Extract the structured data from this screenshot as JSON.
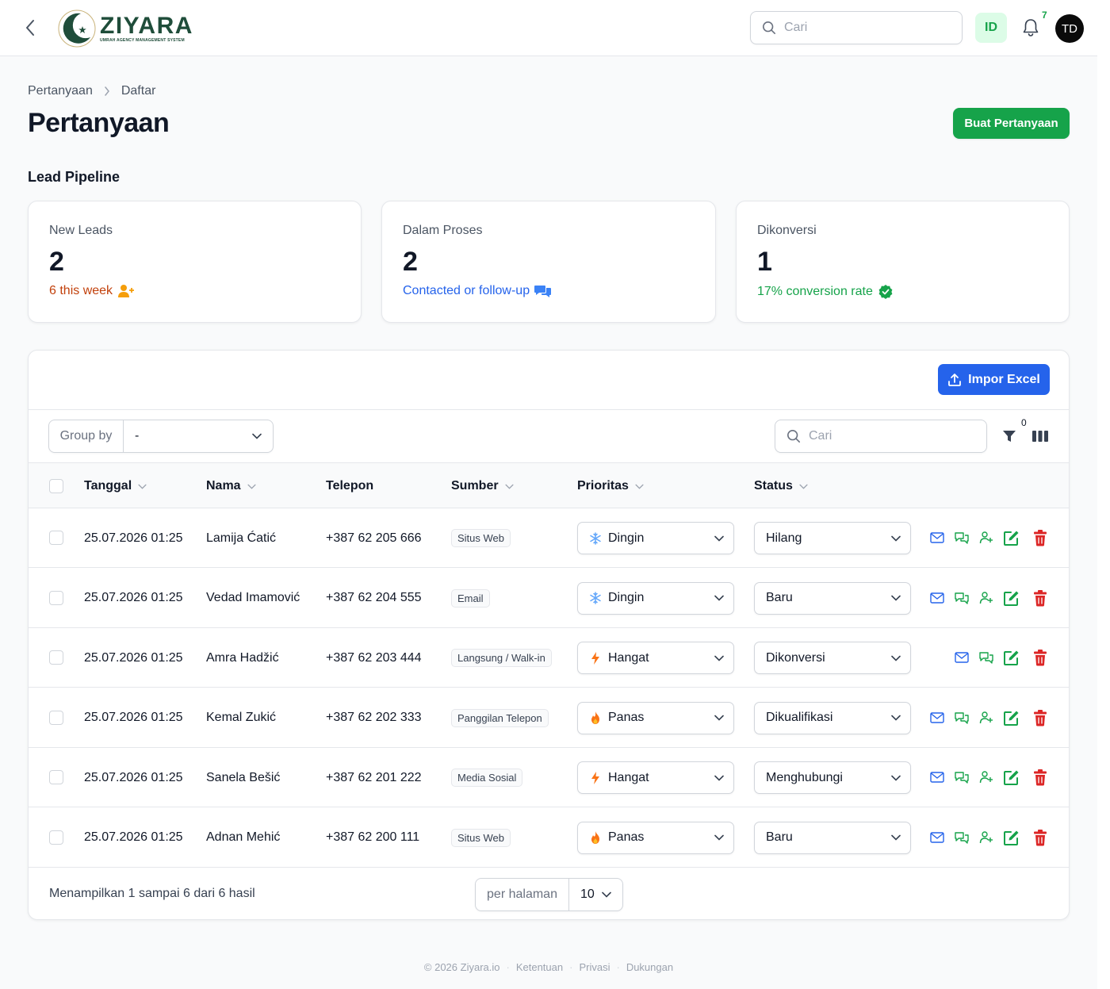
{
  "app": {
    "name": "ZIYARA",
    "tagline": "UMRAH AGENCY MANAGEMENT SYSTEM",
    "brand_color": "#1f4d3a",
    "accent_color": "#16a34a"
  },
  "topbar": {
    "search_placeholder": "Cari",
    "lang": "ID",
    "notification_count": "7",
    "avatar_initials": "TD"
  },
  "breadcrumb": [
    "Pertanyaan",
    "Daftar"
  ],
  "page": {
    "title": "Pertanyaan",
    "create_button": "Buat Pertanyaan",
    "section_title": "Lead Pipeline"
  },
  "stats": [
    {
      "label": "New Leads",
      "value": "2",
      "desc": "6 this week",
      "color": "#c2410c",
      "icon": "user-plus-icon"
    },
    {
      "label": "Dalam Proses",
      "value": "2",
      "desc": "Contacted or follow-up",
      "color": "#2563eb",
      "icon": "chat-bubbles-icon"
    },
    {
      "label": "Dikonversi",
      "value": "1",
      "desc": "17% conversion rate",
      "color": "#16a34a",
      "icon": "check-badge-icon"
    }
  ],
  "table": {
    "import_button": "Impor Excel",
    "group_by_label": "Group by",
    "group_by_value": "-",
    "search_placeholder": "Cari",
    "filter_count": "0",
    "columns": {
      "date": "Tanggal",
      "name": "Nama",
      "phone": "Telepon",
      "source": "Sumber",
      "priority": "Prioritas",
      "status": "Status"
    },
    "rows": [
      {
        "date": "25.07.2026 01:25",
        "name": "Lamija Ćatić",
        "phone": "+387 62 205 666",
        "source": "Situs Web",
        "priority": "Dingin",
        "priority_icon": "snowflake-icon",
        "status": "Hilang",
        "convertible": true
      },
      {
        "date": "25.07.2026 01:25",
        "name": "Vedad Imamović",
        "phone": "+387 62 204 555",
        "source": "Email",
        "priority": "Dingin",
        "priority_icon": "snowflake-icon",
        "status": "Baru",
        "convertible": true
      },
      {
        "date": "25.07.2026 01:25",
        "name": "Amra Hadžić",
        "phone": "+387 62 203 444",
        "source": "Langsung / Walk-in",
        "priority": "Hangat",
        "priority_icon": "bolt-icon",
        "status": "Dikonversi",
        "convertible": false
      },
      {
        "date": "25.07.2026 01:25",
        "name": "Kemal Zukić",
        "phone": "+387 62 202 333",
        "source": "Panggilan Telepon",
        "priority": "Panas",
        "priority_icon": "fire-icon",
        "status": "Dikualifikasi",
        "convertible": true
      },
      {
        "date": "25.07.2026 01:25",
        "name": "Sanela Bešić",
        "phone": "+387 62 201 222",
        "source": "Media Sosial",
        "priority": "Hangat",
        "priority_icon": "bolt-icon",
        "status": "Menghubungi",
        "convertible": true
      },
      {
        "date": "25.07.2026 01:25",
        "name": "Adnan Mehić",
        "phone": "+387 62 200 111",
        "source": "Situs Web",
        "priority": "Panas",
        "priority_icon": "fire-icon",
        "status": "Baru",
        "convertible": true
      }
    ],
    "summary": "Menampilkan 1 sampai 6 dari 6 hasil",
    "per_page_label": "per halaman",
    "per_page_value": "10"
  },
  "footer": {
    "copyright": "© 2026 Ziyara.io",
    "links": [
      "Ketentuan",
      "Privasi",
      "Dukungan"
    ]
  }
}
